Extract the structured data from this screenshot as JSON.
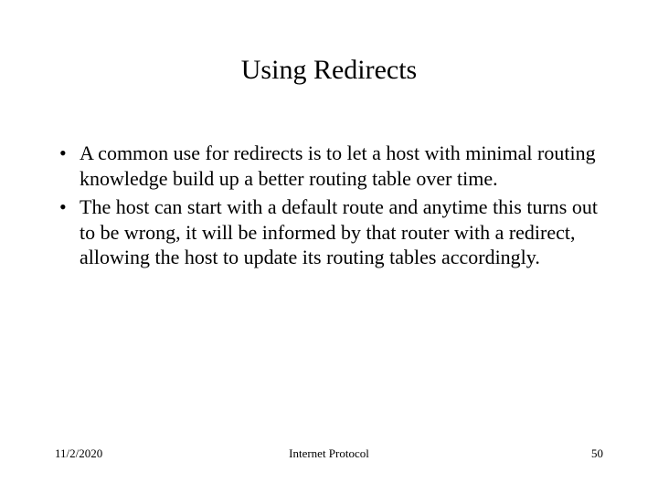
{
  "slide": {
    "title": "Using Redirects",
    "bullets": [
      "A common use for redirects is to let a host with minimal routing knowledge build up a better routing table over time.",
      "The host can start with a default route and anytime this turns out to be wrong, it will be informed by that router with a redirect, allowing the host to update its routing tables accordingly."
    ]
  },
  "footer": {
    "date": "11/2/2020",
    "subject": "Internet Protocol",
    "page": "50"
  }
}
